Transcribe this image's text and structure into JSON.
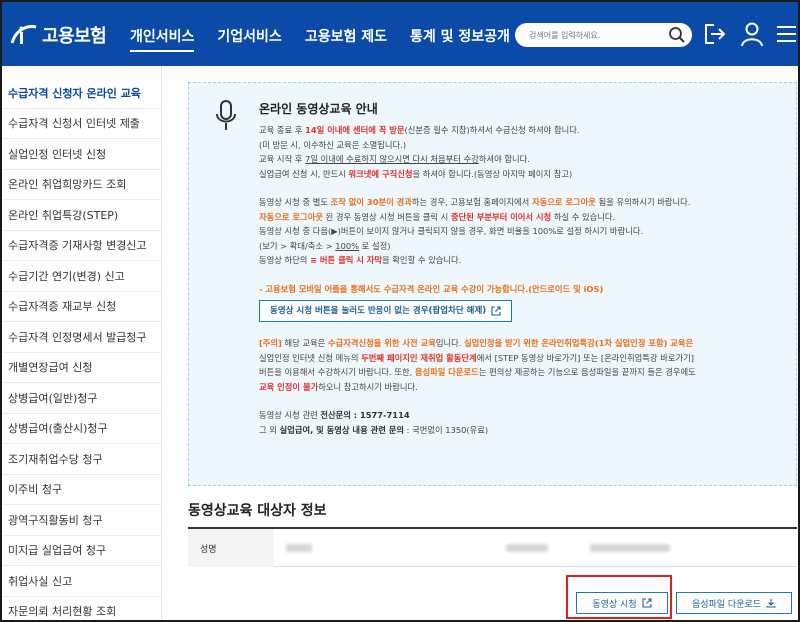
{
  "header": {
    "logo_text": "고용보험",
    "nav": [
      "개인서비스",
      "기업서비스",
      "고용보험 제도",
      "통계 및 정보공개"
    ],
    "search_placeholder": "검색어를 입력하세요."
  },
  "sidebar": {
    "items": [
      "수급자격 신청자 온라인 교육",
      "수급자격 신청서 인터넷 제출",
      "실업인정 인터넷 신청",
      "온라인 취업희망카드 조회",
      "온라인 취업특강(STEP)",
      "수급자격증 기재사항 변경신고",
      "수급기간 연기(변경) 신고",
      "수급자격증 재교부 신청",
      "수급자격 인정명세서 발급청구",
      "개별연장급여 신청",
      "상병급여(일반)청구",
      "상병급여(출산시)청구",
      "조기재취업수당 청구",
      "이주비 청구",
      "광역구직활동비 청구",
      "미지급 실업급여 청구",
      "취업사실 신고",
      "자문의뢰 처리현황 조회"
    ]
  },
  "info": {
    "title": "온라인 동영상교육 안내",
    "p1": [
      [
        "교육 종료 후 ",
        "14일 이내에 센터에 꼭 방문",
        "(신분증 필수 지참)하셔서 수급신청 하셔야 합니다."
      ],
      [
        "(미 방문 시, 이수하신 교육은 소멸됩니다.)"
      ],
      [
        "교육 시작 후 ",
        "7일 이내에 수료하지 않으시면 다시 처음부터 수강",
        "하셔야 합니다."
      ],
      [
        "실업급여 신청 시, 반드시 ",
        "워크넷에 구직신청",
        "을 하셔야 합니다.(동영상 마지막 페이지 참고)"
      ]
    ],
    "p2": [
      [
        "동영상 시청 중 별도 ",
        "조작 없이 30분이 경과",
        "하는 경우, 고용보험 홈페이지에서 ",
        "자동으로 로그아웃",
        " 됨을 유의하시기 바랍니다."
      ],
      [
        "자동으로 로그아웃",
        " 된 경우 동영상 시청 버튼을 클릭 시 ",
        "중단된 부분부터 이어서 시청",
        " 하실 수 있습니다."
      ],
      [
        "동영상 시청 중 다음(▶)버튼이 보이지 않거나 클릭되지 않을 경우, 화면 비율을 100%로 설정 하시기 바랍니다."
      ],
      [
        "(보기 > 확대/축소 > ",
        "100%",
        " 로 설정)"
      ],
      [
        "동영상 하단의 ",
        "≡ 버튼 클릭 시 자막",
        "을 확인할 수 있습니다."
      ]
    ],
    "mobile_note": "- 고용보험 모바일 어플을 통해서도 수급자격 온라인 교육 수강이 가능합니다.(안드로이드 및 iOS)",
    "popup_button": "동영상 시청 버튼을 눌러도 반응이 없는 경우(팝업차단 해제)",
    "p3": [
      [
        "[주의]",
        " 해당 교육은 ",
        "수급자격신청을 위한 사전 교육",
        "입니다. ",
        "실업인정을 받기 위한 온라인취업특강(1차 실업인정 포함) 교육은"
      ],
      [
        "실업인정 인터넷 신청 메뉴의 ",
        "두번째 페이지인 재취업 활동단계",
        "에서 [STEP 동영상 바로가기] 또는 [온라인취업특강 바로가기]"
      ],
      [
        "버튼을 이용해서 수강하시기 바랍니다. 또한, ",
        "음성파일 다운로드",
        "는 편의상 제공하는 기능으로 음성파일을 끝까지 들은 경우에도"
      ],
      [
        "교육 인정이 불가",
        "하오니 참고하시기 바랍니다."
      ]
    ],
    "contact1_label": "동영상 시청 관련 ",
    "contact1_bold": "전산문의 : 1577-7114",
    "contact2_pre": "그 외 ",
    "contact2_bold": "실업급여, 및 동영상 내용 관련 문의",
    "contact2_post": " : 국번없이 1350(유료)"
  },
  "section": {
    "title": "동영상교육 대상자 정보",
    "name_label": "성명"
  },
  "buttons": {
    "watch": "동영상 시청",
    "audio": "음성파일 다운로드"
  }
}
